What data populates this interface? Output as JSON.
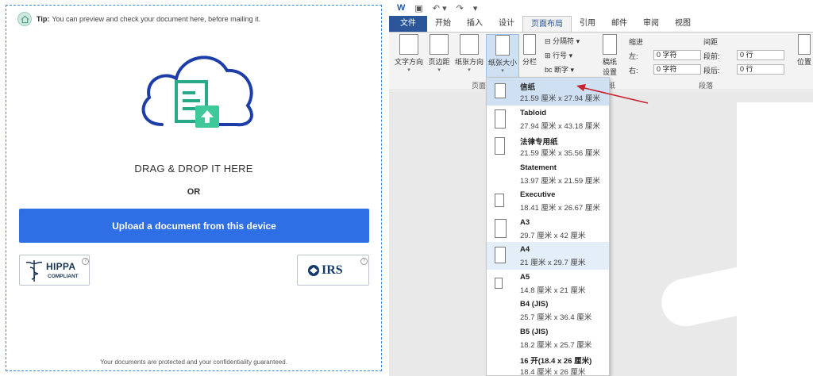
{
  "upload_panel": {
    "tip_label": "Tip:",
    "tip_text": "You can preview and check your document here, before mailing it.",
    "drag_text": "DRAG & DROP IT HERE",
    "or_text": "OR",
    "upload_button": "Upload a document from this device",
    "hippa_title": "HIPPA",
    "hippa_subtitle": "COMPLIANT",
    "irs_text": "IRS",
    "footer": "Your documents are protected and your confidentiality guaranteed.",
    "accent_color": "#2f6fe6"
  },
  "word": {
    "tabs": [
      "文件",
      "开始",
      "插入",
      "设计",
      "页面布局",
      "引用",
      "邮件",
      "审阅",
      "视图"
    ],
    "ribbon": {
      "text_direction": "文字方向",
      "margins": "页边距",
      "orientation": "纸张方向",
      "size": "纸张大小",
      "columns": "分栏",
      "breaks": "分隔符",
      "line_numbers": "行号",
      "hyphenation": "断字",
      "draft_line1": "稿纸",
      "draft_line2": "设置",
      "group_page": "页面",
      "group_draft": "纸",
      "indent_title": "缩进",
      "spacing_title": "间距",
      "left_label": "左:",
      "left_value": "0 字符",
      "right_label": "右:",
      "right_value": "0 字符",
      "before_label": "段前:",
      "before_value": "0 行",
      "after_label": "段后:",
      "after_value": "0 行",
      "group_paragraph": "段落",
      "position": "位置"
    },
    "paper_sizes": [
      {
        "name": "信纸",
        "dims": "21.59 厘米 x 27.94 厘米",
        "selected": true
      },
      {
        "name": "Tabloid",
        "dims": "27.94 厘米 x 43.18 厘米"
      },
      {
        "name": "法律专用纸",
        "dims": "21.59 厘米 x 35.56 厘米"
      },
      {
        "name": "Statement",
        "dims": "13.97 厘米 x 21.59 厘米"
      },
      {
        "name": "Executive",
        "dims": "18.41 厘米 x 26.67 厘米"
      },
      {
        "name": "A3",
        "dims": "29.7 厘米 x 42 厘米"
      },
      {
        "name": "A4",
        "dims": "21 厘米 x 29.7 厘米"
      },
      {
        "name": "A5",
        "dims": "14.8 厘米 x 21 厘米"
      },
      {
        "name": "B4 (JIS)",
        "dims": "25.7 厘米 x 36.4 厘米"
      },
      {
        "name": "B5 (JIS)",
        "dims": "18.2 厘米 x 25.7 厘米"
      },
      {
        "name": "16 开(18.4 x 26 厘米)",
        "dims": "18.4 厘米 x 26 厘米"
      }
    ]
  }
}
